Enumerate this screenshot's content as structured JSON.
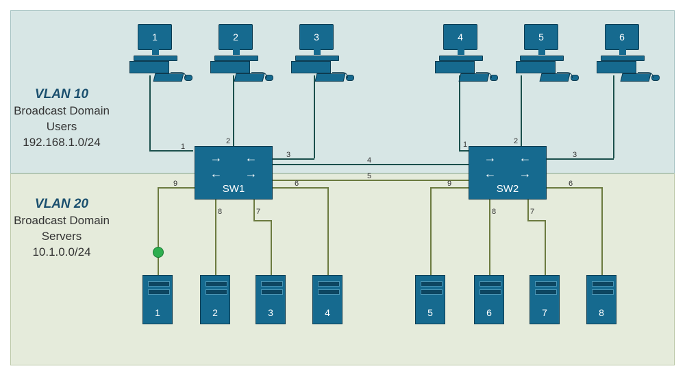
{
  "vlan10": {
    "title": "VLAN 10",
    "line1": "Broadcast Domain",
    "line2": "Users",
    "subnet": "192.168.1.0/24"
  },
  "vlan20": {
    "title": "VLAN 20",
    "line1": "Broadcast Domain",
    "line2": "Servers",
    "subnet": "10.1.0.0/24"
  },
  "switches": {
    "sw1": "SW1",
    "sw2": "SW2"
  },
  "pcs": [
    "1",
    "2",
    "3",
    "4",
    "5",
    "6"
  ],
  "servers": [
    "1",
    "2",
    "3",
    "4",
    "5",
    "6",
    "7",
    "8"
  ],
  "ports": {
    "sw1": {
      "p1": "1",
      "p2": "2",
      "p3": "3",
      "p4": "4",
      "p5": "5",
      "p6": "6",
      "p7": "7",
      "p8": "8",
      "p9": "9"
    },
    "sw2": {
      "p1": "1",
      "p2": "2",
      "p3": "3",
      "p6": "6",
      "p7": "7",
      "p8": "8",
      "p9": "9"
    }
  },
  "colors": {
    "device": "#166a8f",
    "deviceBorder": "#0d3b50",
    "vlan10_bg": "#d7e6e5",
    "vlan20_bg": "#e5ebdb",
    "accent_green": "#2eae4f"
  }
}
